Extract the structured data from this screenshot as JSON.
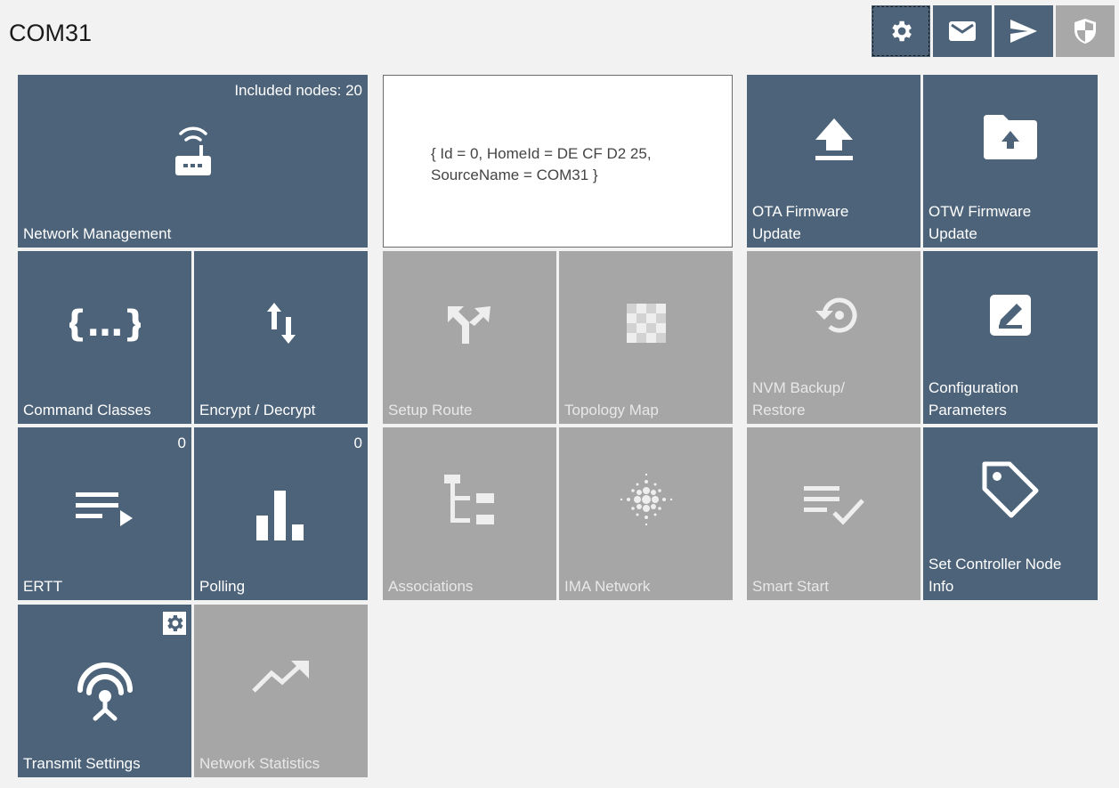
{
  "window": {
    "title": "COM31"
  },
  "toolbar": {
    "settings_icon": "gear-icon",
    "mail_icon": "envelope-icon",
    "send_icon": "send-arrow-icon",
    "security_icon": "shield-icon"
  },
  "info": {
    "line1": "{ Id = 0, HomeId = DE CF D2 25,",
    "line2": "SourceName = COM31 }"
  },
  "tiles": {
    "network_management": {
      "label": "Network Management",
      "badge": "Included nodes: 20",
      "icon": "router-wifi-icon"
    },
    "ota_firmware": {
      "label1": "OTA Firmware",
      "label2": "Update",
      "icon": "upload-icon"
    },
    "otw_firmware": {
      "label1": "OTW Firmware",
      "label2": "Update",
      "icon": "folder-upload-icon"
    },
    "command_classes": {
      "label": "Command Classes",
      "icon": "braces-icon"
    },
    "encrypt_decrypt": {
      "label": "Encrypt / Decrypt",
      "icon": "up-down-arrows-icon"
    },
    "setup_route": {
      "label": "Setup Route",
      "icon": "route-fork-icon"
    },
    "topology_map": {
      "label": "Topology Map",
      "icon": "checker-grid-icon"
    },
    "nvm_backup": {
      "label1": "NVM Backup/",
      "label2": "Restore",
      "icon": "restore-icon"
    },
    "configuration_parameters": {
      "label1": "Configuration",
      "label2": "Parameters",
      "icon": "edit-box-icon"
    },
    "ertt": {
      "label": "ERTT",
      "badge": "0",
      "icon": "list-play-icon"
    },
    "polling": {
      "label": "Polling",
      "badge": "0",
      "icon": "bar-chart-icon"
    },
    "associations": {
      "label": "Associations",
      "icon": "tree-icon"
    },
    "ima_network": {
      "label": "IMA Network",
      "icon": "dot-sphere-icon"
    },
    "smart_start": {
      "label": "Smart Start",
      "icon": "list-check-icon"
    },
    "set_controller_node_info": {
      "label1": "Set Controller Node",
      "label2": "Info",
      "icon": "tag-icon"
    },
    "transmit_settings": {
      "label": "Transmit Settings",
      "icon": "antenna-icon"
    },
    "network_statistics": {
      "label": "Network Statistics",
      "icon": "trend-up-icon"
    }
  },
  "colors": {
    "tile_active": "#4d6379",
    "tile_disabled": "#a6a6a6",
    "background": "#f2f2f2"
  }
}
